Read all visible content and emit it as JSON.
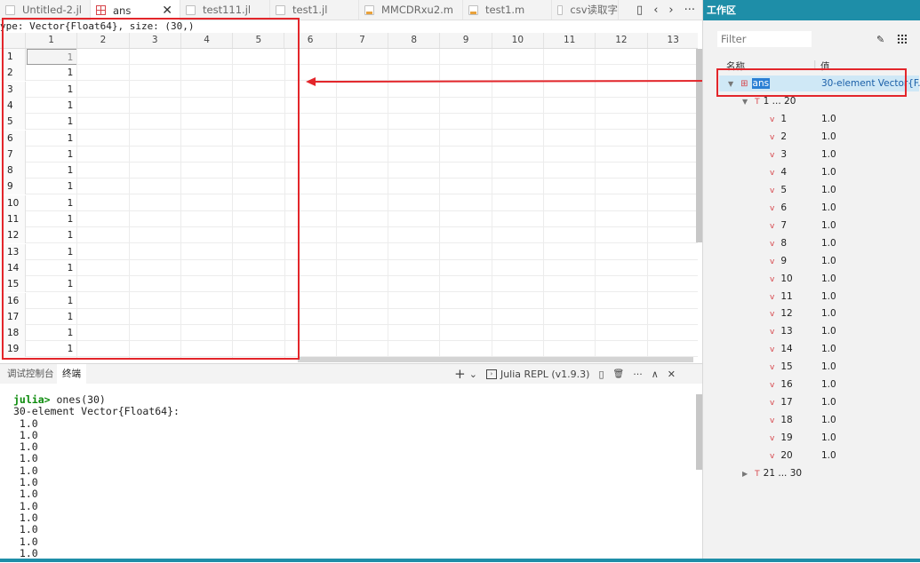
{
  "tabs": [
    {
      "label": "Untitled-2.jl",
      "icon": "julia-file-icon",
      "active": false
    },
    {
      "label": "ans",
      "icon": "table-icon",
      "active": true,
      "closable": true
    },
    {
      "label": "test111.jl",
      "icon": "julia-file-icon",
      "active": false
    },
    {
      "label": "test1.jl",
      "icon": "julia-file-icon",
      "active": false
    },
    {
      "label": "MMCDRxu2.m",
      "icon": "matlab-file-icon",
      "active": false
    },
    {
      "label": "test1.m",
      "icon": "matlab-file-icon",
      "active": false
    },
    {
      "label": "csv读取字",
      "icon": "file-icon",
      "active": false
    }
  ],
  "tab_tools": {
    "split": "▯",
    "prev": "‹",
    "next": "›",
    "more": "···"
  },
  "viewer": {
    "type_line": "ype: Vector{Float64}, size: (30,)",
    "columns": [
      "1",
      "2",
      "3",
      "4",
      "5",
      "6",
      "7",
      "8",
      "9",
      "10",
      "11",
      "12",
      "13"
    ],
    "rows": [
      {
        "index": "1",
        "value": "1"
      },
      {
        "index": "2",
        "value": "1"
      },
      {
        "index": "3",
        "value": "1"
      },
      {
        "index": "4",
        "value": "1"
      },
      {
        "index": "5",
        "value": "1"
      },
      {
        "index": "6",
        "value": "1"
      },
      {
        "index": "7",
        "value": "1"
      },
      {
        "index": "8",
        "value": "1"
      },
      {
        "index": "9",
        "value": "1"
      },
      {
        "index": "10",
        "value": "1"
      },
      {
        "index": "11",
        "value": "1"
      },
      {
        "index": "12",
        "value": "1"
      },
      {
        "index": "13",
        "value": "1"
      },
      {
        "index": "14",
        "value": "1"
      },
      {
        "index": "15",
        "value": "1"
      },
      {
        "index": "16",
        "value": "1"
      },
      {
        "index": "17",
        "value": "1"
      },
      {
        "index": "18",
        "value": "1"
      },
      {
        "index": "19",
        "value": "1"
      }
    ]
  },
  "panel": {
    "tabs": [
      {
        "label": "调试控制台",
        "active": false
      },
      {
        "label": "终端",
        "active": true
      }
    ],
    "tools": {
      "add": "+",
      "dropdown": "⌄",
      "repl_label": "Julia REPL (v1.9.3)",
      "split": "▯",
      "trash": "🗑",
      "more": "···",
      "maximize": "∧",
      "close": "✕"
    },
    "terminal": {
      "prompt": "julia>",
      "command": " ones(30)",
      "output": [
        "30-element Vector{Float64}:",
        " 1.0",
        " 1.0",
        " 1.0",
        " 1.0",
        " 1.0",
        " 1.0",
        " 1.0",
        " 1.0",
        " 1.0",
        " 1.0",
        " 1.0",
        " 1.0"
      ]
    }
  },
  "workspace": {
    "title": "工作区",
    "filter_placeholder": "Filter",
    "col_name": "名称",
    "col_value": "值",
    "variable": {
      "name": "ans",
      "value": "30-element Vector{F..."
    },
    "group1": {
      "label": "1 ... 20"
    },
    "items": [
      {
        "name": "1",
        "value": "1.0"
      },
      {
        "name": "2",
        "value": "1.0"
      },
      {
        "name": "3",
        "value": "1.0"
      },
      {
        "name": "4",
        "value": "1.0"
      },
      {
        "name": "5",
        "value": "1.0"
      },
      {
        "name": "6",
        "value": "1.0"
      },
      {
        "name": "7",
        "value": "1.0"
      },
      {
        "name": "8",
        "value": "1.0"
      },
      {
        "name": "9",
        "value": "1.0"
      },
      {
        "name": "10",
        "value": "1.0"
      },
      {
        "name": "11",
        "value": "1.0"
      },
      {
        "name": "12",
        "value": "1.0"
      },
      {
        "name": "13",
        "value": "1.0"
      },
      {
        "name": "14",
        "value": "1.0"
      },
      {
        "name": "15",
        "value": "1.0"
      },
      {
        "name": "16",
        "value": "1.0"
      },
      {
        "name": "17",
        "value": "1.0"
      },
      {
        "name": "18",
        "value": "1.0"
      },
      {
        "name": "19",
        "value": "1.0"
      },
      {
        "name": "20",
        "value": "1.0"
      }
    ],
    "group2": {
      "label": "21 ... 30"
    }
  },
  "colors": {
    "accent": "#1e8ea8",
    "annotation_red": "#e3262b",
    "prompt_green": "#0a8a0a"
  }
}
